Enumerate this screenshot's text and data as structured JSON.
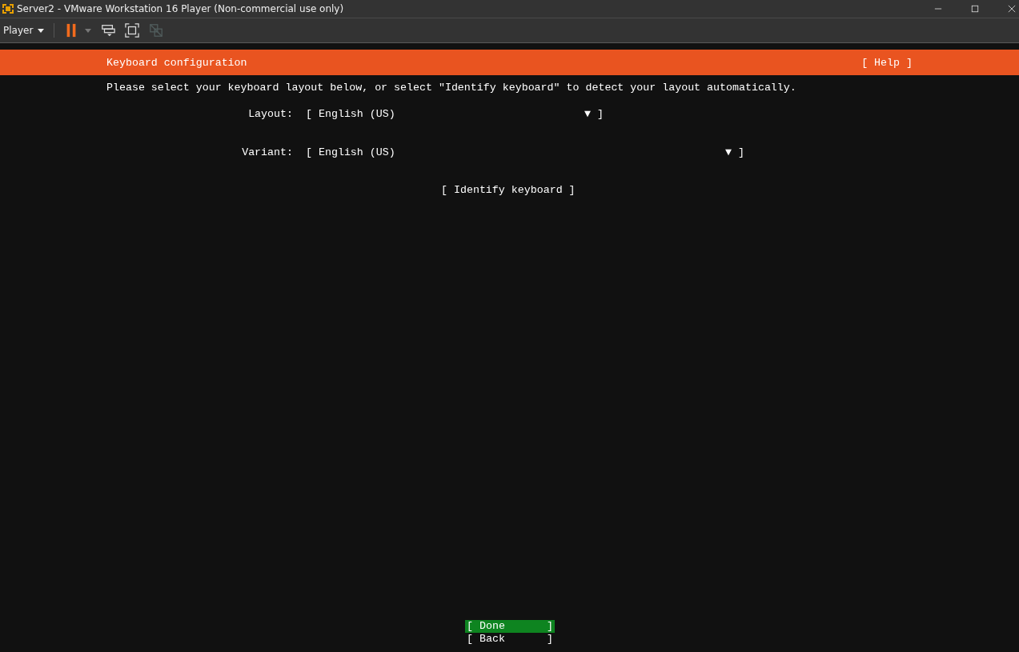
{
  "window": {
    "title": "Server2 - VMware Workstation 16 Player (Non-commercial use only)"
  },
  "toolbar": {
    "menu": "Player",
    "unity_disabled": true
  },
  "header": {
    "title": "Keyboard configuration",
    "help": "[ Help ]"
  },
  "instruction": "Please select your keyboard layout below, or select \"Identify keyboard\" to detect your layout automatically.",
  "fields": [
    {
      "label": "Layout:",
      "open": "[",
      "value": "English (US)",
      "arrow": "▼",
      "close": "]"
    },
    {
      "label": "Variant:",
      "open": "[",
      "value": "English (US)",
      "arrow": "▼",
      "close": "]"
    }
  ],
  "identify_button": "[ Identify keyboard ]",
  "buttons": [
    {
      "open": "[",
      "label": "Done",
      "close": "]",
      "selected": true
    },
    {
      "open": "[",
      "label": "Back",
      "close": "]",
      "selected": false
    }
  ]
}
